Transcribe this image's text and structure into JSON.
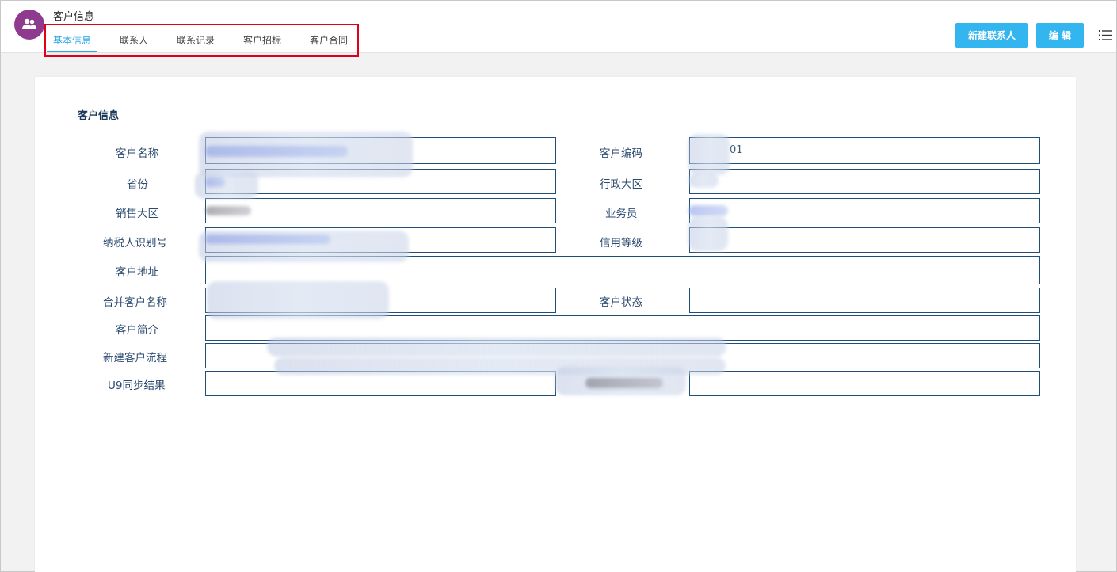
{
  "header": {
    "app_title": "客户信息",
    "avatar_icon": "users-icon",
    "tabs": [
      {
        "label": "基本信息",
        "active": true
      },
      {
        "label": "联系人",
        "active": false
      },
      {
        "label": "联系记录",
        "active": false
      },
      {
        "label": "客户招标",
        "active": false
      },
      {
        "label": "客户合同",
        "active": false
      }
    ],
    "new_contact_label": "新建联系人",
    "edit_label": "编 辑",
    "menu_icon": "list-icon",
    "accent_color": "#2ea6e6",
    "highlight_color": "#e1001a"
  },
  "section": {
    "title": "客户信息"
  },
  "fields": {
    "customer_name": {
      "label": "客户名称",
      "value": ""
    },
    "customer_code": {
      "label": "客户编码",
      "value": "01"
    },
    "province": {
      "label": "省份",
      "value": ""
    },
    "admin_region": {
      "label": "行政大区",
      "value": ""
    },
    "sales_region": {
      "label": "销售大区",
      "value": ""
    },
    "salesperson": {
      "label": "业务员",
      "value": ""
    },
    "tax_id": {
      "label": "纳税人识别号",
      "value": ""
    },
    "credit_level": {
      "label": "信用等级",
      "value": ""
    },
    "address": {
      "label": "客户地址",
      "value": ""
    },
    "merged_name": {
      "label": "合并客户名称",
      "value": ""
    },
    "status": {
      "label": "客户状态",
      "value": ""
    },
    "intro": {
      "label": "客户简介",
      "value": ""
    },
    "new_process": {
      "label": "新建客户流程",
      "value": ""
    },
    "u9_result": {
      "label": "U9同步结果",
      "value": ""
    }
  }
}
